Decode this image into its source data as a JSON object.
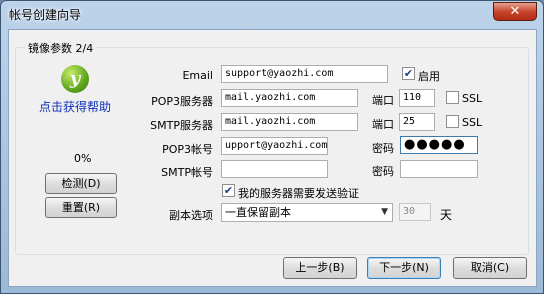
{
  "window": {
    "title": "帐号创建向导",
    "close_icon": "close-icon"
  },
  "group": {
    "title": "镜像参数 2/4"
  },
  "side": {
    "logo_glyph": "y",
    "help_link": "点击获得帮助",
    "progress": "0%",
    "check_button": "检测(D)",
    "reset_button": "重置(R)"
  },
  "form": {
    "email_label": "Email",
    "email_value": "support@yaozhi.com",
    "enable_label": "启用",
    "enable_checked": true,
    "pop3_server_label": "POP3服务器",
    "pop3_server_value": "mail.yaozhi.com",
    "pop3_port_label": "端口",
    "pop3_port_value": "110",
    "pop3_ssl_label": "SSL",
    "smtp_server_label": "SMTP服务器",
    "smtp_server_value": "mail.yaozhi.com",
    "smtp_port_label": "端口",
    "smtp_port_value": "25",
    "smtp_ssl_label": "SSL",
    "pop3_account_label": "POP3帐号",
    "pop3_account_value": "upport@yaozhi.com",
    "pop3_password_label": "密码",
    "pop3_password_value": "●●●●●",
    "smtp_account_label": "SMTP帐号",
    "smtp_account_value": "",
    "smtp_password_label": "密码",
    "smtp_password_value": "",
    "smtp_auth_label": "我的服务器需要发送验证",
    "smtp_auth_checked": true,
    "copy_option_label": "副本选项",
    "copy_option_value": "一直保留副本",
    "days_value": "30",
    "days_unit": "天"
  },
  "footer": {
    "prev_button": "上一步(B)",
    "next_button": "下一步(N)",
    "cancel_button": "取消(C)"
  }
}
